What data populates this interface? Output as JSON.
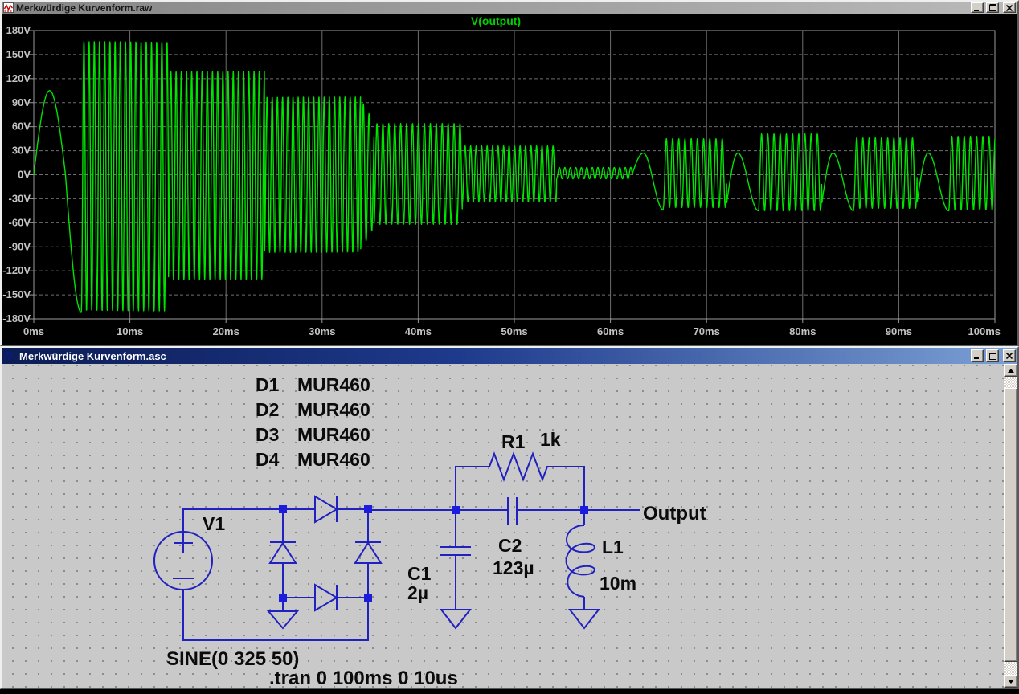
{
  "waveform_window": {
    "title": "Merkwürdige Kurvenform.raw",
    "legend": "V(output)",
    "buttons": {
      "minimize": "minimize",
      "maximize": "maximize",
      "close": "close"
    }
  },
  "chart_data": {
    "type": "line",
    "title": "V(output)",
    "x_unit": "ms",
    "y_unit": "V",
    "xlim": [
      0,
      100
    ],
    "ylim": [
      -180,
      180
    ],
    "x_tick_values": [
      0,
      10,
      20,
      30,
      40,
      50,
      60,
      70,
      80,
      90,
      100
    ],
    "x_ticks": [
      "0ms",
      "10ms",
      "20ms",
      "30ms",
      "40ms",
      "50ms",
      "60ms",
      "70ms",
      "80ms",
      "90ms",
      "100ms"
    ],
    "y_tick_values": [
      180,
      150,
      120,
      90,
      60,
      30,
      0,
      -30,
      -60,
      -90,
      -120,
      -150,
      -180
    ],
    "y_ticks": [
      "180V",
      "150V",
      "120V",
      "90V",
      "60V",
      "30V",
      "0V",
      "-30V",
      "-60V",
      "-90V",
      "-120V",
      "-150V",
      "-180V"
    ],
    "grid": true,
    "legend_position": "top-center",
    "background": "#000000",
    "grid_color": "#6f6f6f",
    "axis_text_color": "#c4c4c4",
    "series": [
      {
        "name": "V(output)",
        "color": "#00e400",
        "synthesis_segments": [
          {
            "type": "half_sine",
            "t0": 0,
            "t1": 3.3,
            "amp": 105
          },
          {
            "type": "quarter_sine",
            "t0": 3.3,
            "t1": 4.95,
            "amp": -172
          },
          {
            "type": "tone",
            "t0": 4.95,
            "t1": 14.0,
            "freq": 1.85,
            "amp": 168,
            "center": -2,
            "phase_deg": -90
          },
          {
            "type": "tone",
            "t0": 14.0,
            "t1": 24.0,
            "freq": 1.85,
            "amp": 130,
            "center": -1,
            "phase_deg": -90
          },
          {
            "type": "tone",
            "t0": 24.0,
            "t1": 34.0,
            "freq": 1.85,
            "amp": 97,
            "center": 0,
            "phase_deg": -90
          },
          {
            "type": "tone",
            "t0": 34.0,
            "t1": 35.4,
            "freq": 1.7,
            "amp": 95,
            "amp_end": 65,
            "center": 0,
            "phase_deg": -90
          },
          {
            "type": "tone",
            "t0": 35.4,
            "t1": 44.6,
            "freq": 1.62,
            "amp": 63,
            "center": 1,
            "phase_deg": -90
          },
          {
            "type": "tone",
            "t0": 44.6,
            "t1": 54.4,
            "freq": 1.75,
            "amp": 35,
            "center": 1,
            "phase_deg": -90
          },
          {
            "type": "tone",
            "t0": 54.4,
            "t1": 62.3,
            "freq": 1.75,
            "amp": 7,
            "center": 2,
            "phase_deg": -90
          },
          {
            "type": "hump",
            "t0": 62.3,
            "t1": 65.5,
            "start": 2,
            "peak": 27,
            "end": -44
          },
          {
            "type": "tone",
            "t0": 65.5,
            "t1": 72.1,
            "freq": 1.55,
            "amp": 43,
            "center": 2,
            "phase_deg": -90
          },
          {
            "type": "hump",
            "t0": 72.1,
            "t1": 75.4,
            "start": -35,
            "peak": 27,
            "end": -45
          },
          {
            "type": "tone",
            "t0": 75.4,
            "t1": 82.0,
            "freq": 1.55,
            "amp": 48,
            "center": 3,
            "phase_deg": -90
          },
          {
            "type": "hump",
            "t0": 82.0,
            "t1": 85.3,
            "start": -35,
            "peak": 27,
            "end": -45
          },
          {
            "type": "tone",
            "t0": 85.3,
            "t1": 91.9,
            "freq": 1.55,
            "amp": 44,
            "center": 2,
            "phase_deg": -90
          },
          {
            "type": "hump",
            "t0": 91.9,
            "t1": 95.2,
            "start": -35,
            "peak": 27,
            "end": -45
          },
          {
            "type": "tone",
            "t0": 95.2,
            "t1": 100.01,
            "freq": 1.55,
            "amp": 46,
            "center": 2,
            "phase_deg": -90
          }
        ]
      }
    ]
  },
  "schematic_window": {
    "title": "Merkwürdige Kurvenform.asc",
    "buttons": {
      "minimize": "minimize",
      "maximize": "maximize",
      "close": "close"
    },
    "diode_table": [
      {
        "ref": "D1",
        "value": "MUR460"
      },
      {
        "ref": "D2",
        "value": "MUR460"
      },
      {
        "ref": "D3",
        "value": "MUR460"
      },
      {
        "ref": "D4",
        "value": "MUR460"
      }
    ],
    "labels": {
      "v1": "V1",
      "r1": "R1",
      "r1_value": "1k",
      "c1": "C1",
      "c1_value": "2µ",
      "c2": "C2",
      "c2_value": "123µ",
      "l1": "L1",
      "l1_value": "10m",
      "output_net": "Output",
      "sine_directive": "SINE(0 325 50)",
      "tran_directive": ".tran 0 100ms 0 10us"
    },
    "wire_color": "#2121c0",
    "background_color": "#c9c9c9"
  }
}
